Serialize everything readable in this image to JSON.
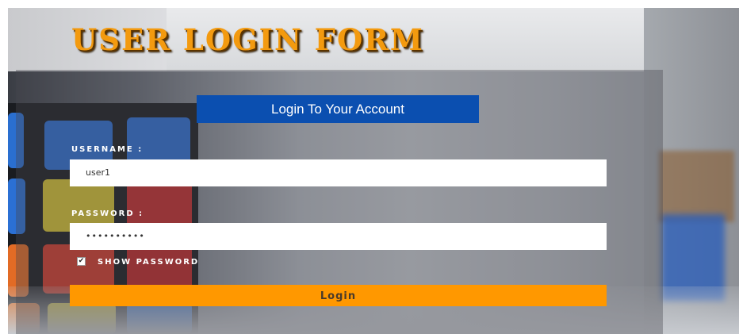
{
  "page": {
    "title": "USER LOGIN FORM"
  },
  "form": {
    "heading": "Login To Your Account",
    "username_label": "USERNAME :",
    "username_value": "user1",
    "password_label": "PASSWORD :",
    "password_value": "••••••••••",
    "show_password_label": "SHOW PASSWORD",
    "show_password_checked": true,
    "login_label": "Login"
  },
  "colors": {
    "title": "#f39a0f",
    "heading_bg": "#0b4fb0",
    "login_button": "#ff9800"
  }
}
